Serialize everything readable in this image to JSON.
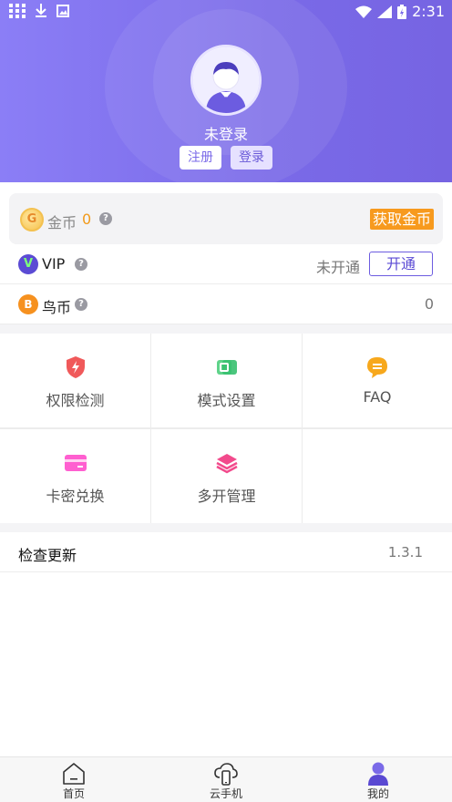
{
  "status_bar": {
    "time": "2:31"
  },
  "profile": {
    "username": "未登录",
    "register_label": "注册",
    "login_label": "登录"
  },
  "coins": {
    "label": "金币",
    "value": "0",
    "get_label": "获取金币",
    "icon_letter": "G"
  },
  "vip": {
    "label": "VIP",
    "status": "未开通",
    "open_label": "开通",
    "icon_letter": "V"
  },
  "bird_coin": {
    "label": "鸟币",
    "value": "0",
    "icon_letter": "B"
  },
  "help_glyph": "?",
  "grid": [
    {
      "label": "权限检测",
      "icon": "shield-icon"
    },
    {
      "label": "模式设置",
      "icon": "mode-icon"
    },
    {
      "label": "FAQ",
      "icon": "faq-chat-icon"
    },
    {
      "label": "卡密兑换",
      "icon": "card-icon"
    },
    {
      "label": "多开管理",
      "icon": "layers-icon"
    }
  ],
  "update": {
    "label": "检查更新",
    "version": "1.3.1"
  },
  "tabs": [
    {
      "label": "首页",
      "icon": "home-icon"
    },
    {
      "label": "云手机",
      "icon": "cloud-phone-icon"
    },
    {
      "label": "我的",
      "icon": "profile-icon"
    }
  ],
  "colors": {
    "brand": "#7a6ae8",
    "accent_orange": "#f79a1e",
    "vip_purple": "#5b4bd4"
  }
}
